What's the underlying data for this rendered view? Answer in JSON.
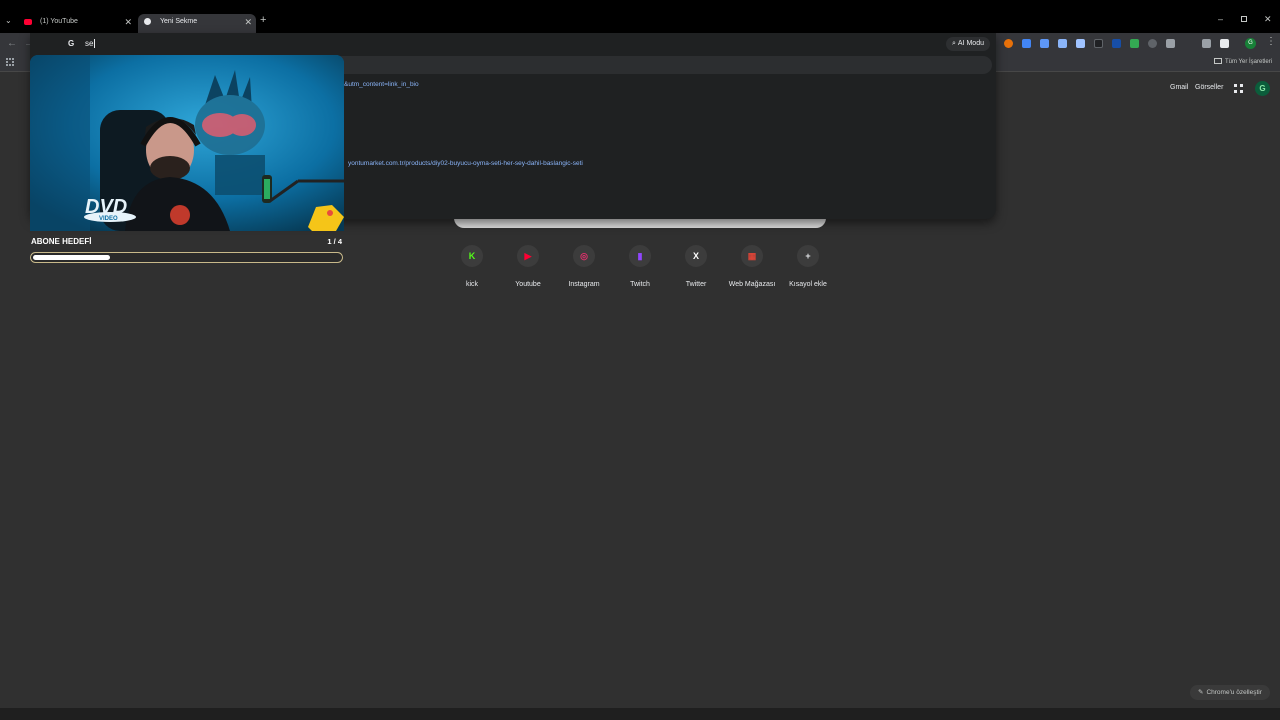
{
  "tabs": [
    {
      "title": "(1) YouTube",
      "favicon": "youtube-icon",
      "color": "#ff0033"
    },
    {
      "title": "Yeni Sekme",
      "favicon": "chrome-icon",
      "color": "#e8eaed"
    }
  ],
  "omnibox": {
    "query": "se",
    "ai_mode_label": "AI Modu",
    "suggestions": [
      {
        "text": "&utm_content=link_in_bio"
      },
      {
        "text": "yontumarket.com.tr/products/diy02-buyucu-oyma-seti-her-sey-dahil-baslangic-seti"
      }
    ]
  },
  "bookmarks": {
    "all_bookmarks_label": "Tüm Yer İşaretleri"
  },
  "google_header": {
    "gmail": "Gmail",
    "images": "Görseller",
    "avatar_letter": "G"
  },
  "shortcuts": [
    {
      "label": "kick",
      "icon": "kick-icon",
      "color": "#53fc18"
    },
    {
      "label": "Youtube",
      "icon": "youtube-icon",
      "color": "#ff0033"
    },
    {
      "label": "Instagram",
      "icon": "instagram-icon",
      "color": "#e1306c"
    },
    {
      "label": "Twitch",
      "icon": "twitch-icon",
      "color": "#9146ff"
    },
    {
      "label": "Twitter",
      "icon": "x-icon",
      "color": "#ffffff"
    },
    {
      "label": "Web Mağazası",
      "icon": "webstore-icon",
      "color": "#db4437"
    },
    {
      "label": "Kısayol ekle",
      "icon": "plus-icon",
      "color": "#e8eaed"
    }
  ],
  "customize_label": "Chrome'u özelleştir",
  "overlay": {
    "goal_label": "ABONE HEDEFİ",
    "goal_count": "1 / 4",
    "progress": 0.25,
    "dvd_text": "DVD",
    "dvd_sub": "VIDEO"
  }
}
